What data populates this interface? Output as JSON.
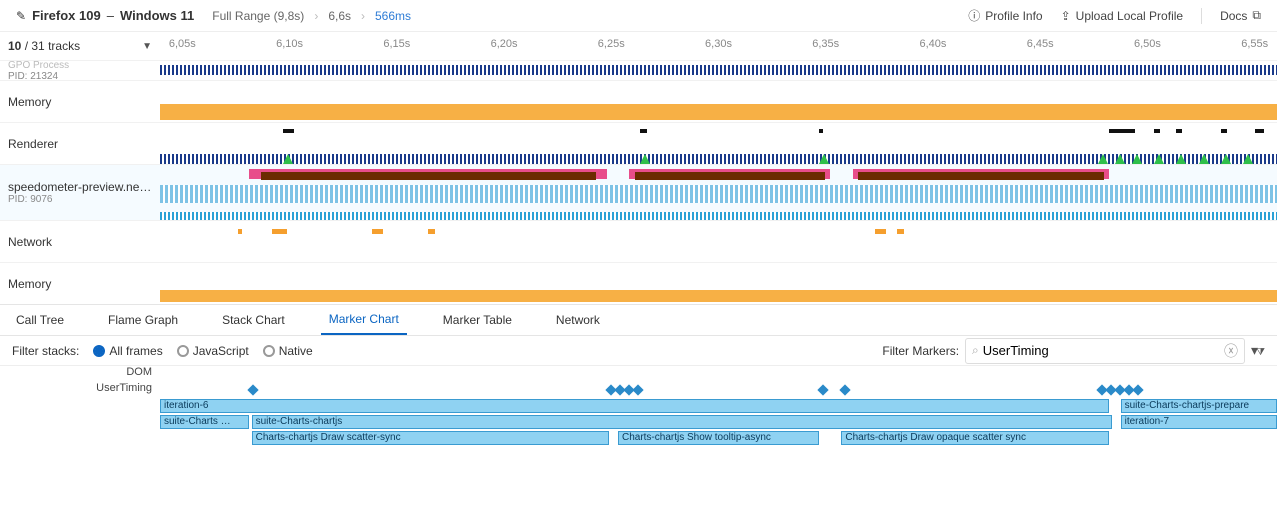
{
  "header": {
    "title_app": "Firefox 109",
    "title_os": "Windows 11",
    "breadcrumb": {
      "full_range_label": "Full Range",
      "full_range_value": "(9,8s)",
      "mid": "6,6s",
      "leaf": "566ms"
    },
    "profile_info": "Profile Info",
    "upload": "Upload Local Profile",
    "docs": "Docs"
  },
  "tracks_header": {
    "shown": "10",
    "total": "31",
    "label": "tracks"
  },
  "time_ticks": [
    "6,05s",
    "6,10s",
    "6,15s",
    "6,20s",
    "6,25s",
    "6,30s",
    "6,35s",
    "6,40s",
    "6,45s",
    "6,50s",
    "6,55s"
  ],
  "tracks": {
    "top_trunc_label": "GPO Process",
    "top_pid": "PID: 21324",
    "memory1": "Memory",
    "renderer": "Renderer",
    "speed_label": "speedometer-preview.ne…",
    "speed_pid": "PID: 9076",
    "network": "Network",
    "memory2": "Memory"
  },
  "tabs": [
    "Call Tree",
    "Flame Graph",
    "Stack Chart",
    "Marker Chart",
    "Marker Table",
    "Network"
  ],
  "active_tab": 3,
  "filter": {
    "label": "Filter stacks:",
    "radios": [
      "All frames",
      "JavaScript",
      "Native"
    ],
    "selected": 0,
    "marker_label": "Filter Markers:",
    "marker_value": "UserTiming"
  },
  "marker_chart": {
    "group_dom": "DOM",
    "group_user_timing": "UserTiming",
    "rows": {
      "r1": {
        "a": "iteration-6",
        "b": "suite-Charts-chartjs-prepare"
      },
      "r2": {
        "a": "suite-Charts …",
        "b": "suite-Charts-chartjs",
        "c": "iteration-7"
      },
      "r3": {
        "a": "Charts-chartjs Draw scatter-sync",
        "b": "Charts-chartjs Show tooltip-async",
        "c": "Charts-chartjs Draw opaque scatter sync"
      }
    }
  }
}
